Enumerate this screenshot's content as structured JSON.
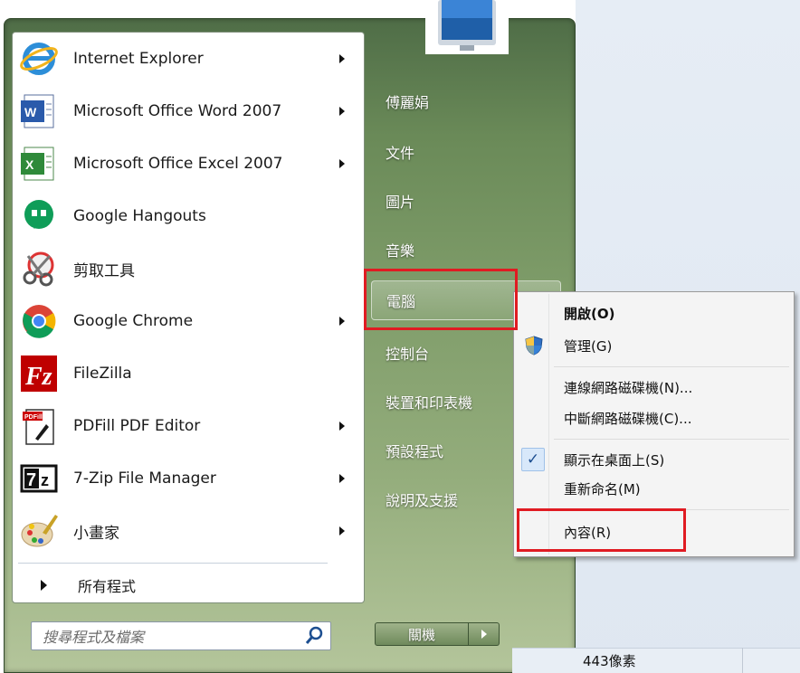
{
  "programs": [
    {
      "label": "Internet Explorer",
      "icon": "internet-explorer-icon",
      "has_submenu": true
    },
    {
      "label": "Microsoft Office Word 2007",
      "icon": "word-icon",
      "has_submenu": true
    },
    {
      "label": "Microsoft Office Excel 2007",
      "icon": "excel-icon",
      "has_submenu": true
    },
    {
      "label": "Google Hangouts",
      "icon": "hangouts-icon",
      "has_submenu": false
    },
    {
      "label": "剪取工具",
      "icon": "snipping-tool-icon",
      "has_submenu": false
    },
    {
      "label": "Google Chrome",
      "icon": "chrome-icon",
      "has_submenu": true
    },
    {
      "label": "FileZilla",
      "icon": "filezilla-icon",
      "has_submenu": false
    },
    {
      "label": "PDFill PDF Editor",
      "icon": "pdfill-icon",
      "has_submenu": true
    },
    {
      "label": "7-Zip File Manager",
      "icon": "7zip-icon",
      "has_submenu": true
    },
    {
      "label": "小畫家",
      "icon": "paint-icon",
      "has_submenu": true
    }
  ],
  "all_programs": "所有程式",
  "search": {
    "placeholder": "搜尋程式及檔案"
  },
  "right_links": [
    {
      "label": "傅麗娟"
    },
    {
      "label": "文件"
    },
    {
      "label": "圖片"
    },
    {
      "label": "音樂"
    },
    {
      "label": "電腦"
    },
    {
      "label": "控制台"
    },
    {
      "label": "裝置和印表機"
    },
    {
      "label": "預設程式"
    },
    {
      "label": "說明及支援"
    }
  ],
  "shutdown": {
    "label": "關機"
  },
  "context_menu": {
    "items": [
      {
        "label": "開啟(O)",
        "bold": true
      },
      {
        "label": "管理(G)",
        "icon": "uac-shield-icon"
      },
      {
        "label": "連線網路磁碟機(N)..."
      },
      {
        "label": "中斷網路磁碟機(C)..."
      },
      {
        "label": "顯示在桌面上(S)",
        "checked": true
      },
      {
        "label": "重新命名(M)"
      },
      {
        "label": "內容(R)"
      }
    ]
  },
  "status_bar": {
    "text": "443像素"
  },
  "colors": {
    "highlight": "#e01b22",
    "menu_green": "#6a8a58"
  }
}
